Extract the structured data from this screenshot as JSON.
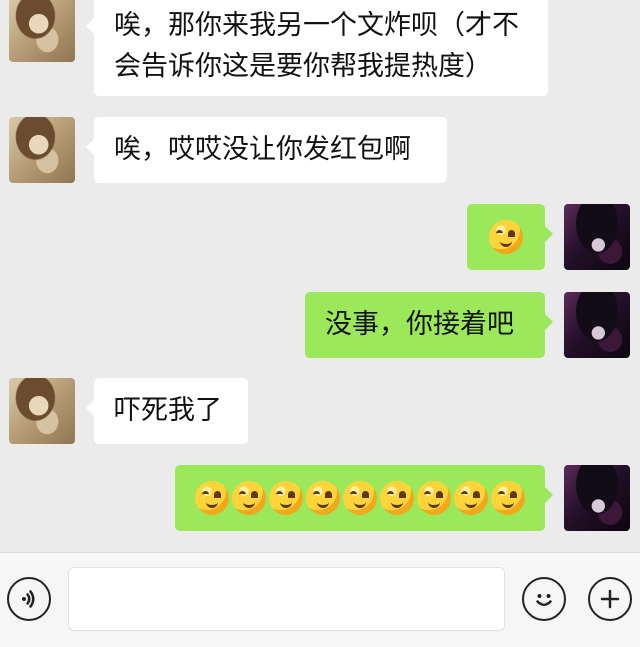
{
  "messages": [
    {
      "id": "m1",
      "sender": "other",
      "text_lines": [
        "唉，那你来我另一个文炸呗（才不",
        "会告诉你这是要你帮我提热度）"
      ],
      "emoji_count": 0
    },
    {
      "id": "m2",
      "sender": "other",
      "text_lines": [
        "唉，哎哎没让你发红包啊"
      ],
      "emoji_count": 0
    },
    {
      "id": "m3",
      "sender": "me",
      "text_lines": [],
      "emoji_count": 1
    },
    {
      "id": "m4",
      "sender": "me",
      "text_lines": [
        "没事，你接着吧"
      ],
      "emoji_count": 0
    },
    {
      "id": "m5",
      "sender": "other",
      "text_lines": [
        "吓死我了"
      ],
      "emoji_count": 0
    },
    {
      "id": "m6",
      "sender": "me",
      "text_lines": [],
      "emoji_count": 9
    }
  ],
  "input_bar": {
    "voice_icon": "voice-icon",
    "emoji_icon": "emoji-icon",
    "plus_icon": "plus-icon",
    "value": ""
  },
  "colors": {
    "chat_background": "#ebebeb",
    "incoming_bubble": "#ffffff",
    "outgoing_bubble": "#9be85b"
  }
}
